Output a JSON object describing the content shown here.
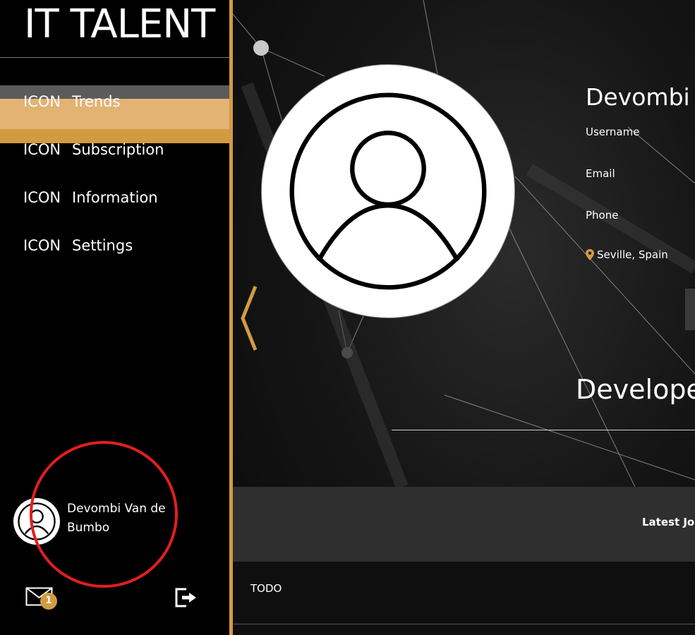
{
  "sidebar": {
    "brand": "IT TALENT",
    "nav": [
      {
        "icon": "ICON",
        "label": "Trends",
        "active": true
      },
      {
        "icon": "ICON",
        "label": "Subscription",
        "active": false
      },
      {
        "icon": "ICON",
        "label": "Information",
        "active": false
      },
      {
        "icon": "ICON",
        "label": "Settings",
        "active": false
      }
    ],
    "user": {
      "name": "Devombi Van de Bumbo"
    },
    "notifications": {
      "count": "1",
      "icon": "mail-icon"
    },
    "logout_icon": "logout-icon"
  },
  "profile": {
    "name": "Devombi V",
    "fields": {
      "username": "Username",
      "email": "Email",
      "phone": "Phone"
    },
    "location": "Seville, Spain",
    "role": "Develope"
  },
  "jobs": {
    "title": "Latest Job",
    "body": "TODO"
  },
  "colors": {
    "accent": "#d39b41",
    "active_nav": "#e2b373",
    "highlight": "#e21e1e"
  }
}
